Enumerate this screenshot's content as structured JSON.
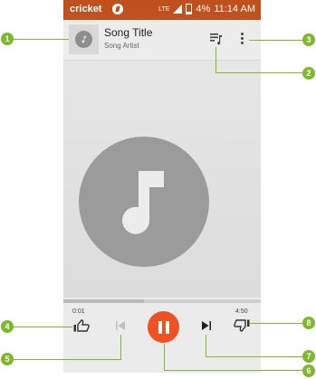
{
  "status_bar": {
    "carrier": "cricket",
    "network": "LTE",
    "battery": "4%",
    "time": "11:14 AM"
  },
  "now_playing": {
    "title": "Song Title",
    "artist": "Song Artist"
  },
  "player": {
    "elapsed": "0:01",
    "duration": "4:50",
    "progress": 0.41,
    "state": "playing"
  },
  "callouts": [
    "1",
    "2",
    "3",
    "4",
    "5",
    "6",
    "7",
    "8"
  ],
  "colors": {
    "status_bar": "#c0501d",
    "play_button": "#f05022",
    "callout": "#7fb82d"
  },
  "icons": {
    "header": [
      "album-thumbnail-icon",
      "queue-icon",
      "more-vert-icon"
    ],
    "controls": [
      "thumbs-up-icon",
      "skip-previous-icon",
      "pause-icon",
      "skip-next-icon",
      "thumbs-down-icon"
    ]
  }
}
